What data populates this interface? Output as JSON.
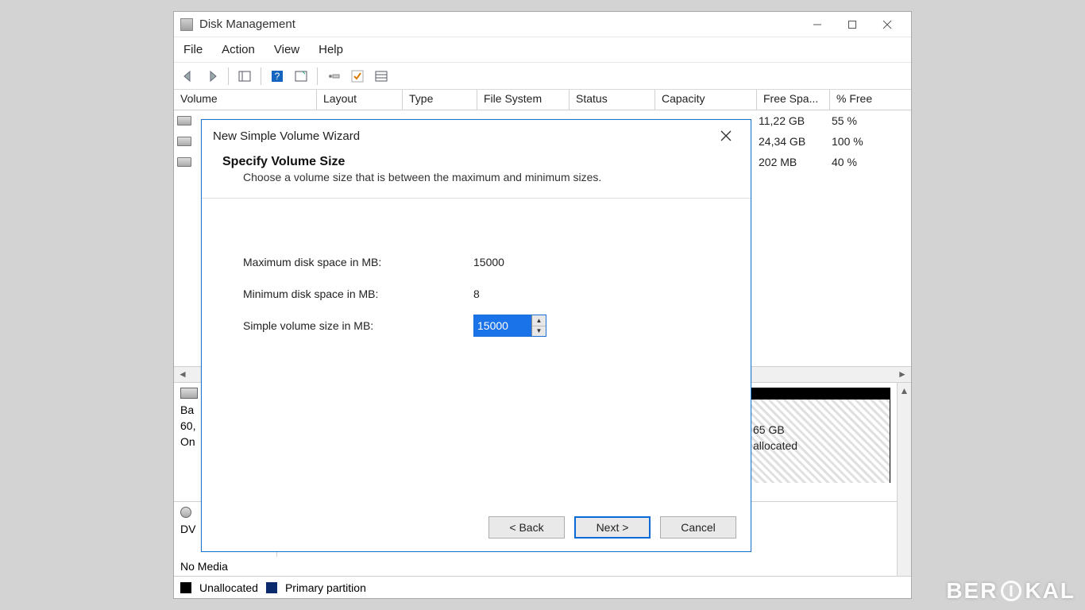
{
  "window": {
    "title": "Disk Management"
  },
  "menu": {
    "file": "File",
    "action": "Action",
    "view": "View",
    "help": "Help"
  },
  "columns": {
    "volume": "Volume",
    "layout": "Layout",
    "type": "Type",
    "filesystem": "File System",
    "status": "Status",
    "capacity": "Capacity",
    "freespace": "Free Spa...",
    "pctfree": "% Free"
  },
  "rows": [
    {
      "free": "11,22 GB",
      "pct": "55 %"
    },
    {
      "free": "24,34 GB",
      "pct": "100 %"
    },
    {
      "free": "202 MB",
      "pct": "40 %"
    }
  ],
  "disk0": {
    "label1": "Ba",
    "label2": "60,",
    "label3": "On",
    "block_size": "65 GB",
    "block_state": "allocated"
  },
  "disk1": {
    "label1": "DV",
    "media": "No Media"
  },
  "legend": {
    "unalloc": "Unallocated",
    "primary": "Primary partition"
  },
  "wizard": {
    "title": "New Simple Volume Wizard",
    "heading": "Specify Volume Size",
    "sub": "Choose a volume size that is between the maximum and minimum sizes.",
    "max_label": "Maximum disk space in MB:",
    "max_value": "15000",
    "min_label": "Minimum disk space in MB:",
    "min_value": "8",
    "size_label": "Simple volume size in MB:",
    "size_value": "15000",
    "back": "< Back",
    "next": "Next >",
    "cancel": "Cancel"
  },
  "watermark": {
    "a": "BER",
    "b": "KAL"
  }
}
